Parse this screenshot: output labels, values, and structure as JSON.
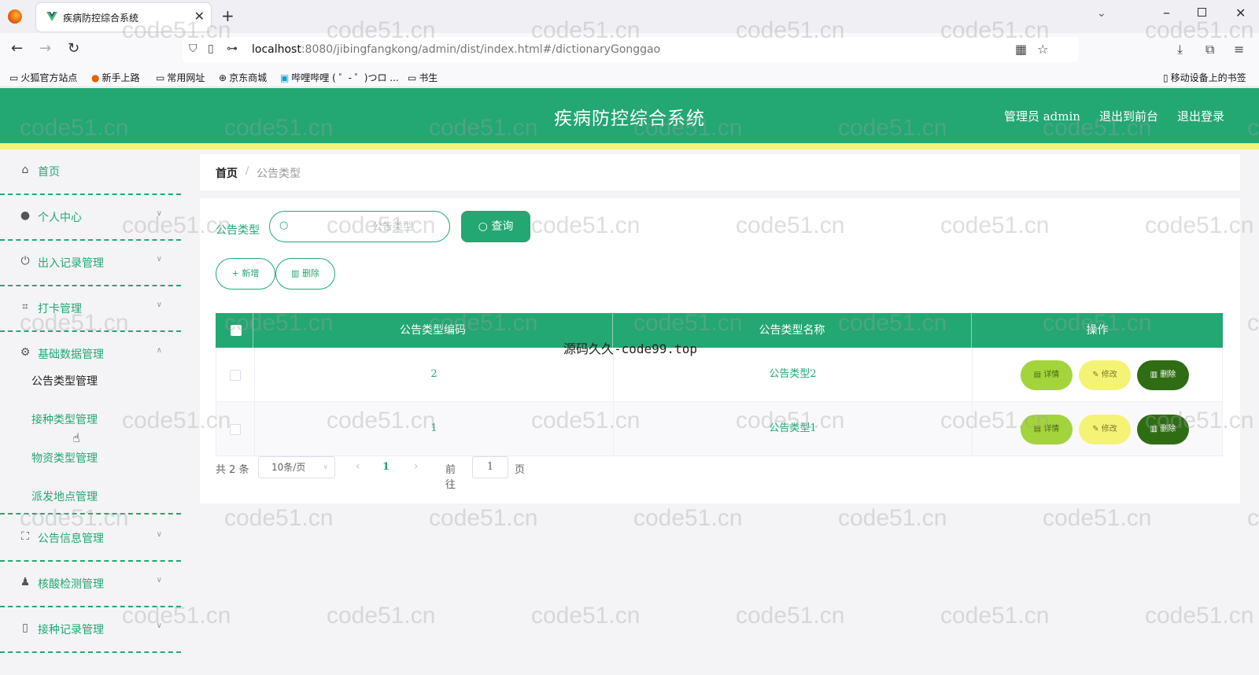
{
  "browser": {
    "tab_title": "疾病防控综合系统",
    "url_host": "localhost",
    "url_rest": ":8080/jibingfangkong/admin/dist/index.html#/dictionaryGonggao",
    "bookmarks": [
      "火狐官方站点",
      "新手上路",
      "常用网址",
      "京东商城",
      "哔哩哔哩 ( ゜- ゜)つロ ...",
      "书生"
    ],
    "mobile_bookmarks": "移动设备上的书签"
  },
  "header": {
    "title": "疾病防控综合系统",
    "user": "管理员 admin",
    "to_front": "退出到前台",
    "logout": "退出登录"
  },
  "sidebar": {
    "items": [
      {
        "label": "首页",
        "icon": "home-icon"
      },
      {
        "label": "个人中心",
        "icon": "user-icon"
      },
      {
        "label": "出入记录管理",
        "icon": "power-icon"
      },
      {
        "label": "打卡管理",
        "icon": "crop-icon"
      },
      {
        "label": "基础数据管理",
        "icon": "gear-icon"
      },
      {
        "label": "公告信息管理",
        "icon": "fullscreen-icon"
      },
      {
        "label": "核酸检测管理",
        "icon": "person-icon"
      },
      {
        "label": "接种记录管理",
        "icon": "phone-icon"
      }
    ],
    "submenu": [
      "公告类型管理",
      "接种类型管理",
      "物资类型管理",
      "派发地点管理"
    ]
  },
  "breadcrumb": {
    "home": "首页",
    "sep": "/",
    "current": "公告类型"
  },
  "search": {
    "label": "公告类型",
    "placeholder": "公告类型",
    "query_btn": "查询"
  },
  "actions": {
    "add": "新增",
    "delete": "删除"
  },
  "table": {
    "headers": [
      "公告类型编码",
      "公告类型名称",
      "操作"
    ],
    "rows": [
      {
        "code": "2",
        "name": "公告类型2"
      },
      {
        "code": "1",
        "name": "公告类型1"
      }
    ],
    "op_detail": "详情",
    "op_edit": "修改",
    "op_delete": "删除"
  },
  "pager": {
    "total": "共 2 条",
    "size": "10条/页",
    "current": "1",
    "goto_label": "前往",
    "goto_value": "1",
    "page_label": "页"
  },
  "watermark": {
    "center": "源码久久-code99.top",
    "tile": "code51.cn"
  },
  "colors": {
    "primary": "#23a773",
    "strip": "#f5f376",
    "detail": "#a4d43c",
    "edit": "#f5f376",
    "delete": "#2f6d15"
  }
}
